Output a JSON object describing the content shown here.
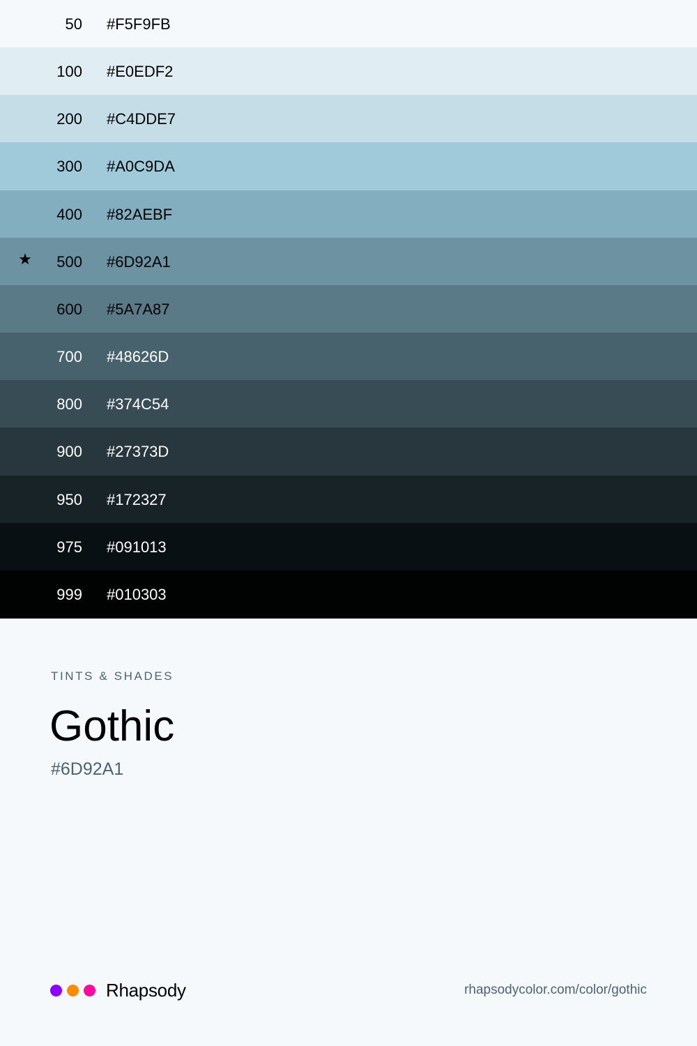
{
  "swatches": [
    {
      "step": "50",
      "hex": "#F5F9FB",
      "text_color": "#000000",
      "selected": false
    },
    {
      "step": "100",
      "hex": "#E0EDF2",
      "text_color": "#000000",
      "selected": false
    },
    {
      "step": "200",
      "hex": "#C4DDE7",
      "text_color": "#000000",
      "selected": false
    },
    {
      "step": "300",
      "hex": "#A0C9DA",
      "text_color": "#000000",
      "selected": false
    },
    {
      "step": "400",
      "hex": "#82AEBF",
      "text_color": "#000000",
      "selected": false
    },
    {
      "step": "500",
      "hex": "#6D92A1",
      "text_color": "#000000",
      "selected": true
    },
    {
      "step": "600",
      "hex": "#5A7A87",
      "text_color": "#000000",
      "selected": false
    },
    {
      "step": "700",
      "hex": "#48626D",
      "text_color": "#FFFFFF",
      "selected": false
    },
    {
      "step": "800",
      "hex": "#374C54",
      "text_color": "#FFFFFF",
      "selected": false
    },
    {
      "step": "900",
      "hex": "#27373D",
      "text_color": "#FFFFFF",
      "selected": false
    },
    {
      "step": "950",
      "hex": "#172327",
      "text_color": "#FFFFFF",
      "selected": false
    },
    {
      "step": "975",
      "hex": "#091013",
      "text_color": "#FFFFFF",
      "selected": false
    },
    {
      "step": "999",
      "hex": "#010303",
      "text_color": "#FFFFFF",
      "selected": false
    }
  ],
  "selected_marker": "★",
  "section": {
    "eyebrow": "TINTS & SHADES",
    "name": "Gothic",
    "hex": "#6D92A1"
  },
  "footer": {
    "brand_name": "Rhapsody",
    "brand_dots": [
      "#8B00FF",
      "#FF8C00",
      "#FF0A9C"
    ],
    "url": "rhapsodycolor.com/color/gothic"
  },
  "colors": {
    "background": "#F5F9FB",
    "muted_text": "#4C6470"
  }
}
